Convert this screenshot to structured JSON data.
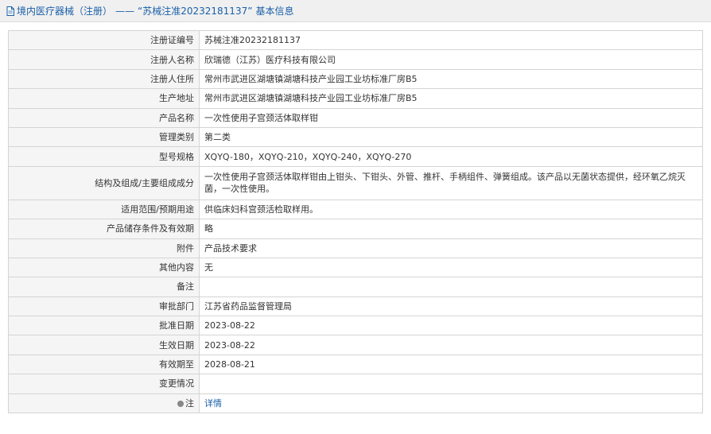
{
  "header": {
    "category": "境内医疗器械（注册）",
    "separator": "——",
    "subtitle": "“苏械注准20232181137”",
    "suffix": "基本信息"
  },
  "rows": [
    {
      "label": "注册证编号",
      "value": "苏械注准20232181137"
    },
    {
      "label": "注册人名称",
      "value": "欣瑞德（江苏）医疗科技有限公司"
    },
    {
      "label": "注册人住所",
      "value": "常州市武进区湖塘镇湖塘科技产业园工业坊标准厂房B5"
    },
    {
      "label": "生产地址",
      "value": "常州市武进区湖塘镇湖塘科技产业园工业坊标准厂房B5"
    },
    {
      "label": "产品名称",
      "value": "一次性使用子宫颈活体取样钳"
    },
    {
      "label": "管理类别",
      "value": "第二类"
    },
    {
      "label": "型号规格",
      "value": "XQYQ-180，XQYQ-210，XQYQ-240，XQYQ-270"
    },
    {
      "label": "结构及组成/主要组成成分",
      "value": "一次性使用子宫颈活体取样钳由上钳头、下钳头、外管、推杆、手柄组件、弹簧组成。该产品以无菌状态提供，经环氧乙烷灭菌，一次性使用。"
    },
    {
      "label": "适用范围/预期用途",
      "value": "供临床妇科宫颈活检取样用。"
    },
    {
      "label": "产品储存条件及有效期",
      "value": "略"
    },
    {
      "label": "附件",
      "value": "产品技术要求"
    },
    {
      "label": "其他内容",
      "value": "无"
    },
    {
      "label": "备注",
      "value": ""
    },
    {
      "label": "审批部门",
      "value": "江苏省药品监督管理局"
    },
    {
      "label": "批准日期",
      "value": "2023-08-22"
    },
    {
      "label": "生效日期",
      "value": "2023-08-22"
    },
    {
      "label": "有效期至",
      "value": "2028-08-21"
    },
    {
      "label": "变更情况",
      "value": ""
    }
  ],
  "note": {
    "label": "注",
    "link_text": "详情"
  },
  "colors": {
    "link": "#1a5fa8",
    "label_bg": "#f5f5f5",
    "border": "#d4d4d4"
  }
}
